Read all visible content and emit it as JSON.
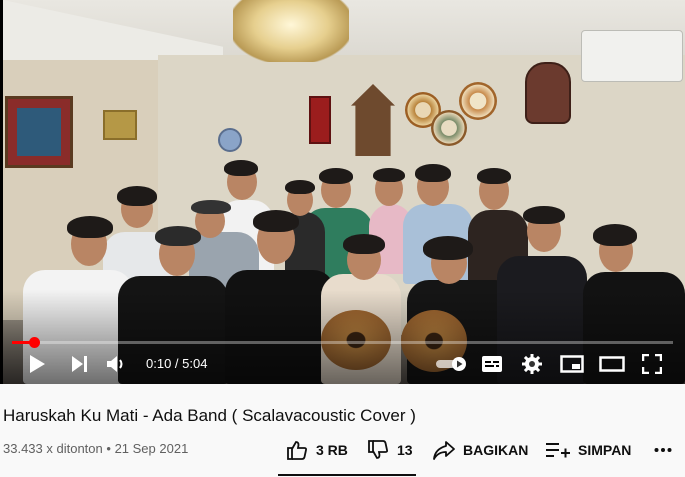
{
  "player": {
    "time_display": "0:10 / 5:04",
    "progress_fraction": 0.033,
    "accent_color": "#ff0000",
    "controls": {
      "play": "play-icon",
      "next": "next-icon",
      "volume": "volume-icon",
      "autoplay": "autoplay-toggle",
      "subtitles": "subtitles-icon",
      "settings": "gear-icon",
      "miniplayer": "miniplayer-icon",
      "theater": "theater-icon",
      "fullscreen": "fullscreen-icon"
    }
  },
  "video": {
    "title": "Haruskah Ku Mati - Ada Band ( Scalavacoustic Cover )",
    "views": "33.433 x ditonton",
    "separator": "•",
    "date": "21 Sep 2021"
  },
  "actions": {
    "like_count": "3 RB",
    "dislike_count": "13",
    "share_label": "BAGIKAN",
    "save_label": "SIMPAN",
    "more": "more-icon"
  }
}
